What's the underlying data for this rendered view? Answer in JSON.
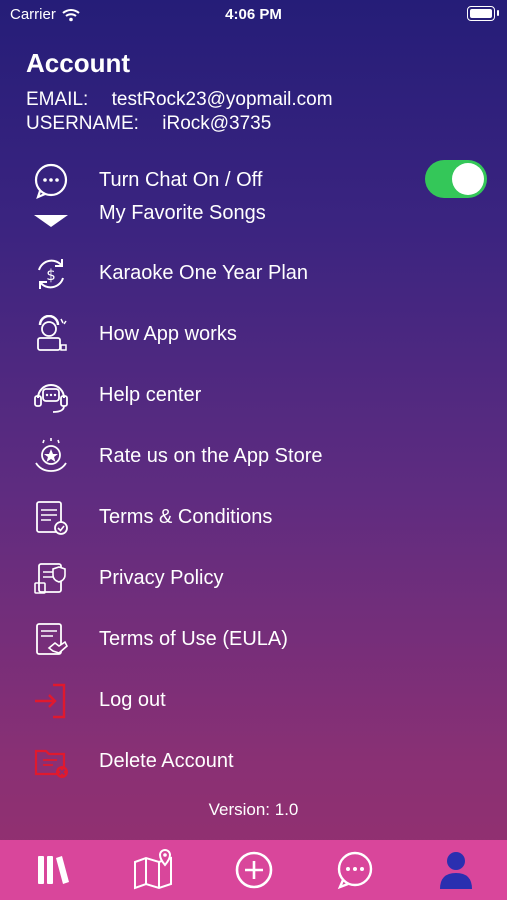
{
  "status_bar": {
    "carrier": "Carrier",
    "time": "4:06 PM"
  },
  "account": {
    "title": "Account",
    "email_label": "EMAIL:",
    "email": "testRock23@yopmail.com",
    "username_label": "USERNAME:",
    "username": "iRock@3735"
  },
  "menu": {
    "chat_toggle": {
      "label": "Turn Chat On / Off",
      "icon": "chat-bubble-icon",
      "on": true
    },
    "items": [
      {
        "label": "My Favorite Songs",
        "icon": "triangle-down-icon"
      },
      {
        "label": "Karaoke One Year Plan",
        "icon": "dollar-cycle-icon"
      },
      {
        "label": "How App works",
        "icon": "person-laptop-icon"
      },
      {
        "label": "Help center",
        "icon": "headset-icon"
      },
      {
        "label": "Rate us on the App Store",
        "icon": "star-award-icon"
      },
      {
        "label": "Terms & Conditions",
        "icon": "document-check-icon"
      },
      {
        "label": "Privacy Policy",
        "icon": "shield-document-icon"
      },
      {
        "label": "Terms of Use (EULA)",
        "icon": "document-handshake-icon"
      },
      {
        "label": "Log out",
        "icon": "logout-icon"
      },
      {
        "label": "Delete Account",
        "icon": "folder-delete-icon"
      }
    ]
  },
  "version": "Version: 1.0",
  "tab_bar": {
    "tabs": [
      {
        "icon": "library-icon",
        "active": false
      },
      {
        "icon": "map-pin-icon",
        "active": false
      },
      {
        "icon": "plus-circle-icon",
        "active": false
      },
      {
        "icon": "chat-icon",
        "active": false
      },
      {
        "icon": "user-icon",
        "active": true
      }
    ],
    "active_color": "#2a2fb0"
  },
  "colors": {
    "toggle_on": "#34c759",
    "danger": "#e0192e",
    "tab_bar_bg": "#d9469b"
  }
}
